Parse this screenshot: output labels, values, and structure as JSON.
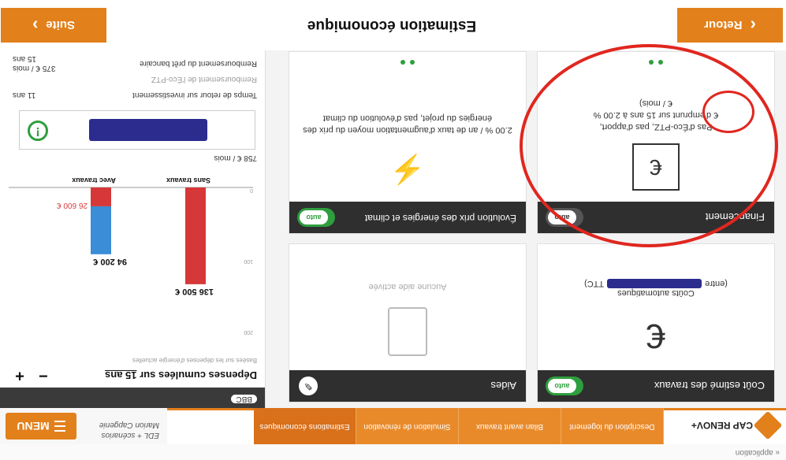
{
  "app": {
    "topstrip": "« application",
    "brand": "CAP RENOV+",
    "user_line1": "EDL + scénarios",
    "user_line2": "Marion Capgenie",
    "menu_label": "MENU"
  },
  "steps": [
    {
      "label": "Description du logement"
    },
    {
      "label": "Bilan avant travaux"
    },
    {
      "label": "Simulation de rénovation"
    },
    {
      "label": "Estimations économiques"
    }
  ],
  "header": {
    "prev_label": "Retour",
    "next_label": "Suite",
    "title": "Estimation économique"
  },
  "cards": {
    "cout": {
      "title": "Coût estimé des travaux",
      "toggle": "auto",
      "sub1": "Coûts automatiques",
      "sub2": "(entre",
      "sub3": "TTC)",
      "icon": "euro-hand-icon"
    },
    "aides": {
      "title": "Aides",
      "caption": "Aucune aide activée",
      "icon": "document-icon"
    },
    "financement": {
      "title": "Financement",
      "toggle": "auto",
      "text1": "Pas d'Éco-PTZ, pas d'apport,",
      "text2": "€ d'emprunt sur 15 ans à 2.00 %",
      "text3": "€ / mois)",
      "icon": "euro-vault-icon"
    },
    "evolution": {
      "title": "Évolution prix des énergies et climat",
      "toggle": "auto",
      "text": "2.00 % / an de taux d'augmentation moyen du prix des énergies du projet, pas d'évolution du climat",
      "icon": "weather-energy-icon"
    }
  },
  "side": {
    "bbc_label": "BBC",
    "exp_title_prefix": "Dépenses cumulées sur",
    "exp_years": "15 ans",
    "exp_sub": "Basées sur les dépenses d'énergie actuelles",
    "minus": "−",
    "plus": "+",
    "sans_travaux_label": "Sans travaux",
    "avec_travaux_label": "Avec travaux",
    "sans_travaux_value": "136 500 €",
    "avec_travaux_value": "94 200 €",
    "aux_value": "26 600 €",
    "sans_travaux_monthly": "758 € / mois",
    "roi_label": "Temps de retour sur investissement",
    "roi_value": "11 ans",
    "rem_label": "Remboursement de l'Éco-PTZ",
    "bank_label": "Remboursement du prêt bancaire",
    "bank_value": "375 € / mois",
    "bank_years": "15 ans"
  },
  "chart_data": {
    "type": "bar",
    "ylim": [
      0,
      200
    ],
    "ticks": [
      "0",
      "100",
      "200"
    ],
    "series": [
      {
        "name": "Sans travaux",
        "value": 136500,
        "color": "#d6383a"
      },
      {
        "name": "Avec travaux",
        "value": 94200,
        "color": "#3a8dd6",
        "stack_red": 26600
      }
    ]
  }
}
